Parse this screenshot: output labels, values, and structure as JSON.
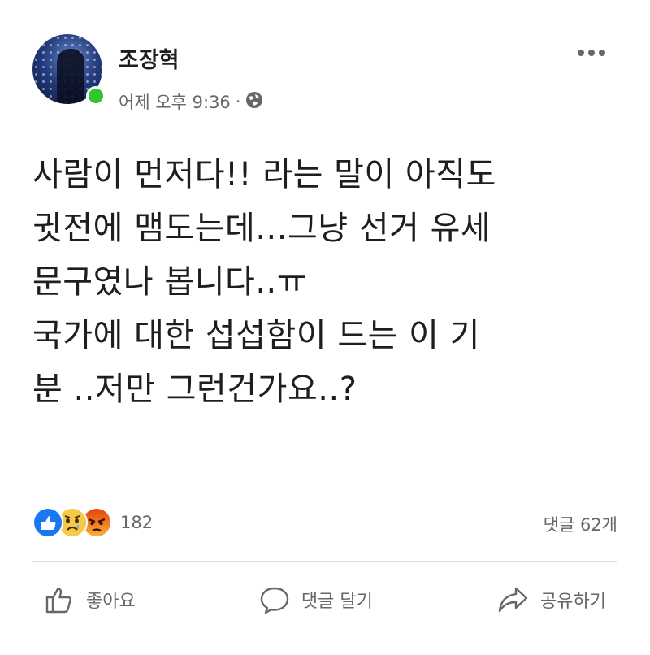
{
  "post": {
    "author": "조장혁",
    "time": "어제 오후 9:36",
    "separator": "·",
    "audience_icon": "globe-icon",
    "body_lines": [
      "사람이 먼저다!! 라는 말이 아직도",
      "귓전에 맴도는데...그냥 선거 유세",
      "문구였나 봅니다..ㅠ",
      "국가에 대한 섭섭함이 드는 이 기",
      "분 ..저만 그런건가요..?"
    ]
  },
  "reactions": {
    "icons": [
      "like-reaction-icon",
      "sad-reaction-icon",
      "angry-reaction-icon"
    ],
    "count": "182",
    "comments": "댓글 62개"
  },
  "actions": {
    "like": "좋아요",
    "comment": "댓글 달기",
    "share": "공유하기"
  },
  "colors": {
    "online": "#31c631",
    "like_blue": "#1877f2",
    "sad_yellow": "#f7c948",
    "angry_orange": "#e9710f",
    "meta_gray": "#65676b"
  }
}
